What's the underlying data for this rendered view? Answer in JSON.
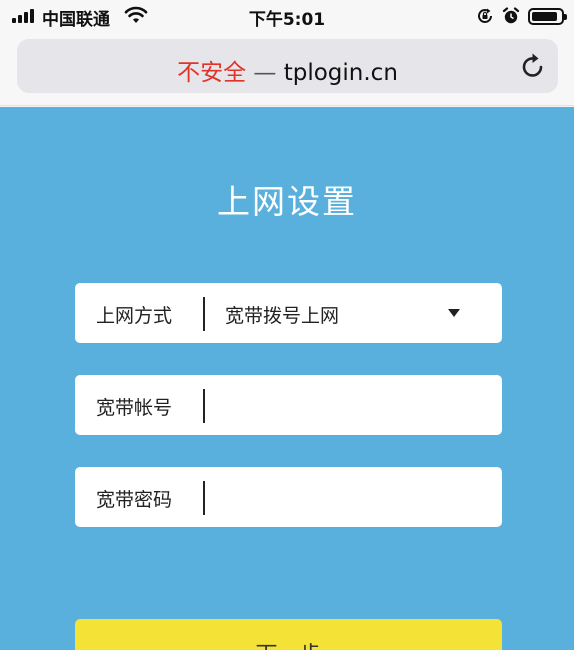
{
  "status_bar": {
    "carrier": "中国联通",
    "time": "下午5:01",
    "battery_level": 0.9
  },
  "address_bar": {
    "security_label": "不安全",
    "separator": "—",
    "url": "tplogin.cn"
  },
  "page": {
    "title": "上网设置",
    "connection_type": {
      "label": "上网方式",
      "selected": "宽带拨号上网"
    },
    "account": {
      "label": "宽带帐号",
      "value": ""
    },
    "password": {
      "label": "宽带密码",
      "value": ""
    },
    "next_button": "下一步"
  },
  "colors": {
    "panel_bg": "#5ab0dd",
    "button_bg": "#f5e236",
    "insecure_text": "#e0342b"
  },
  "icons": [
    "signal-icon",
    "wifi-icon",
    "orientation-lock-icon",
    "alarm-icon",
    "battery-icon",
    "reload-icon",
    "chevron-down-icon"
  ]
}
